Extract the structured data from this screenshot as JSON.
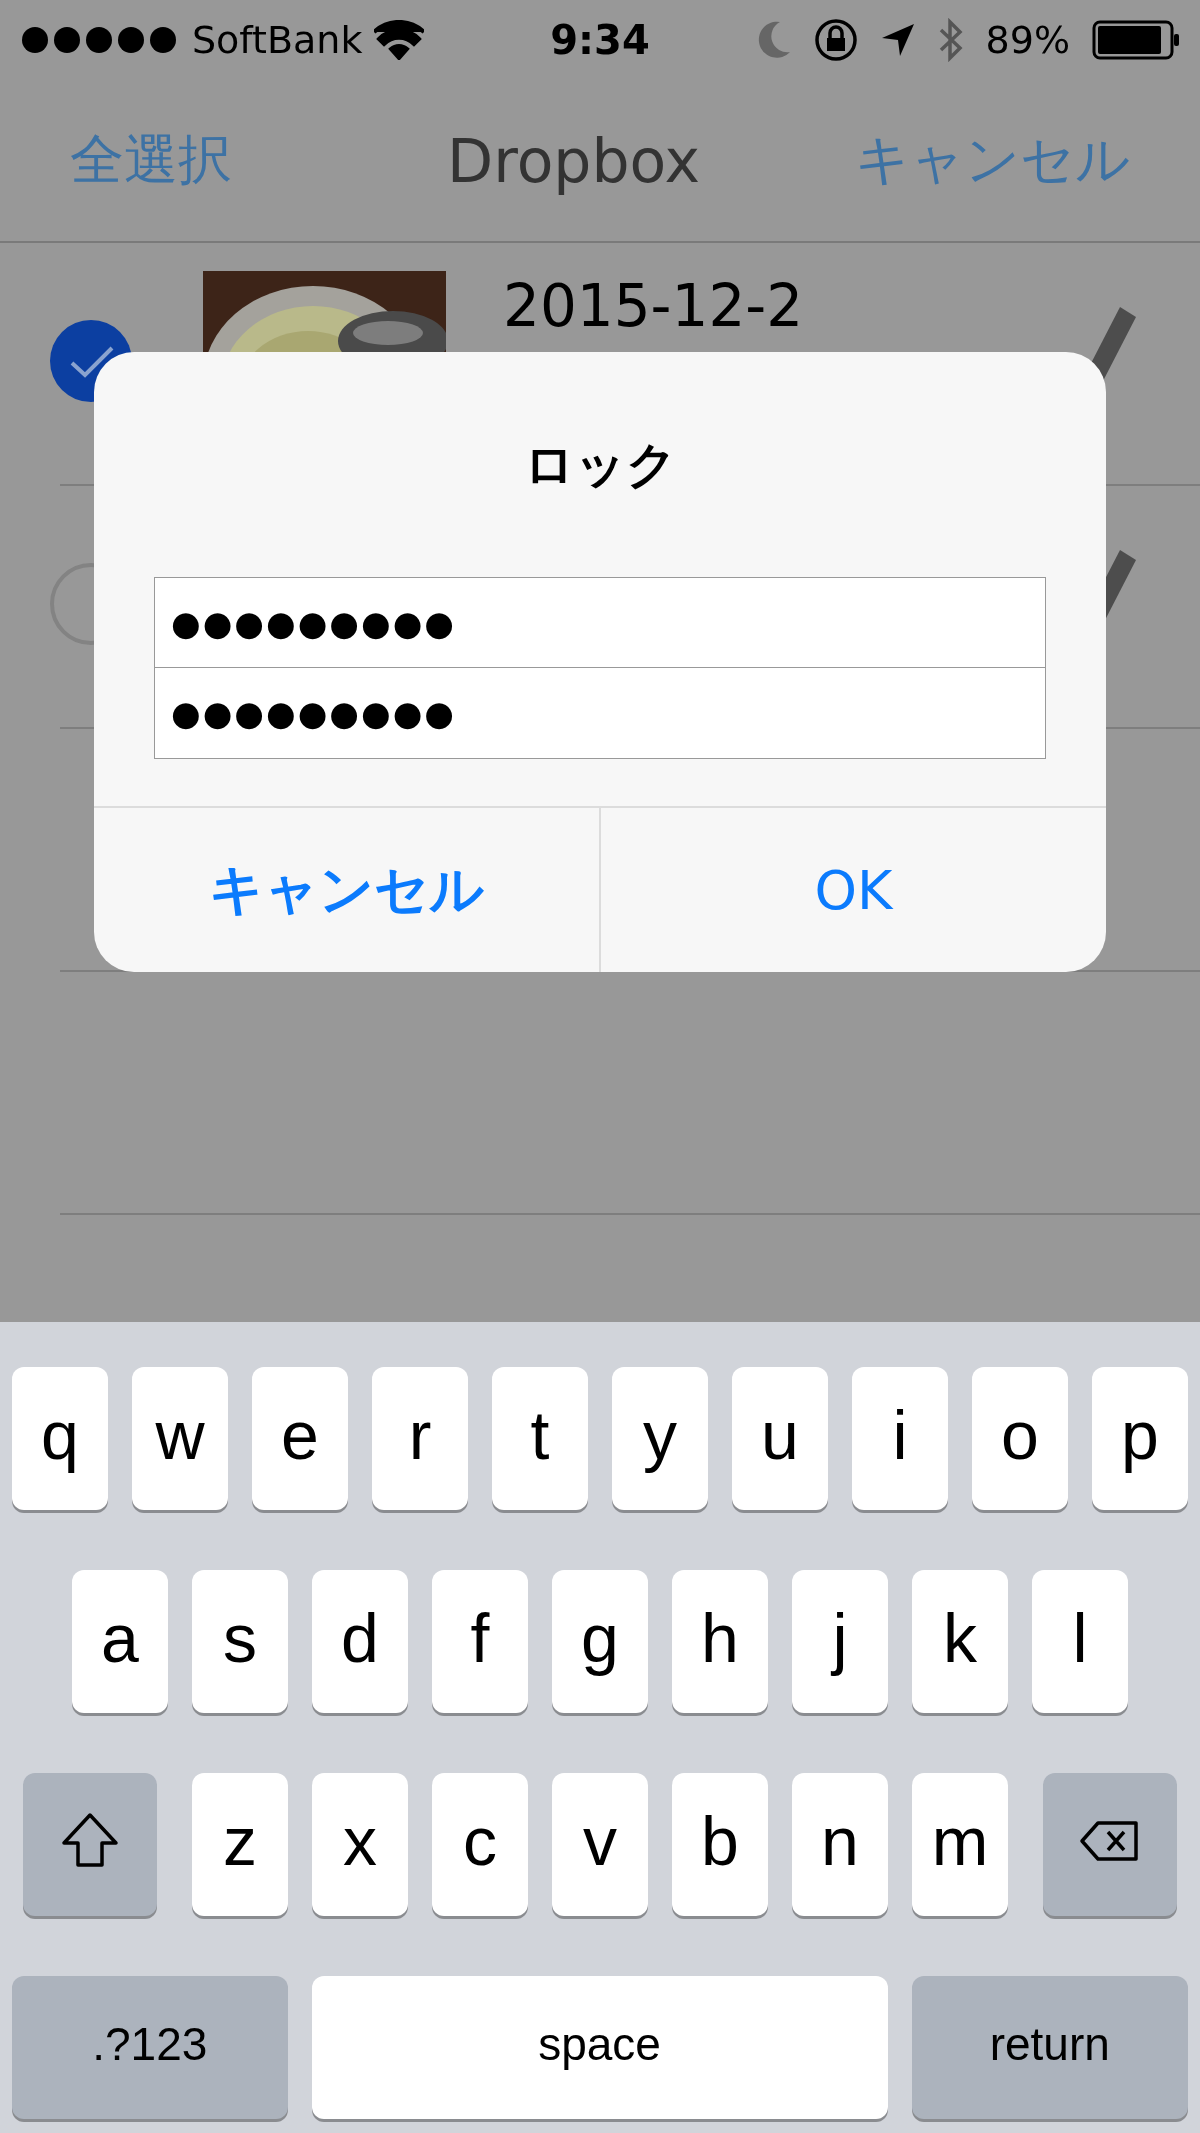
{
  "status_bar": {
    "carrier": "SoftBank",
    "time": "9:34",
    "battery": "89%"
  },
  "nav": {
    "left": "全選択",
    "title": "Dropbox",
    "right": "キャンセル"
  },
  "files": [
    {
      "name": "2015-12-2",
      "selected": true
    },
    {
      "selected": false
    }
  ],
  "dialog": {
    "title": "ロック",
    "fields": [
      {
        "value": "●●●●●●●●●"
      },
      {
        "value": "●●●●●●●●●"
      }
    ],
    "buttons": [
      {
        "label": "キャンセル",
        "kind": "cancel"
      },
      {
        "label": "OK",
        "kind": "default"
      }
    ]
  },
  "keyboard": {
    "rows": [
      {
        "keys": [
          {
            "kind": "letter",
            "label": "q"
          },
          {
            "kind": "letter",
            "label": "w"
          },
          {
            "kind": "letter",
            "label": "e"
          },
          {
            "kind": "letter",
            "label": "r"
          },
          {
            "kind": "letter",
            "label": "t"
          },
          {
            "kind": "letter",
            "label": "y"
          },
          {
            "kind": "letter",
            "label": "u"
          },
          {
            "kind": "letter",
            "label": "i"
          },
          {
            "kind": "letter",
            "label": "o"
          },
          {
            "kind": "letter",
            "label": "p"
          }
        ]
      },
      {
        "keys": [
          {
            "kind": "letter",
            "label": "a"
          },
          {
            "kind": "letter",
            "label": "s"
          },
          {
            "kind": "letter",
            "label": "d"
          },
          {
            "kind": "letter",
            "label": "f"
          },
          {
            "kind": "letter",
            "label": "g"
          },
          {
            "kind": "letter",
            "label": "h"
          },
          {
            "kind": "letter",
            "label": "j"
          },
          {
            "kind": "letter",
            "label": "k"
          },
          {
            "kind": "letter",
            "label": "l"
          }
        ]
      },
      {
        "keys": [
          {
            "kind": "shift"
          },
          {
            "kind": "letter",
            "label": "z"
          },
          {
            "kind": "letter",
            "label": "x"
          },
          {
            "kind": "letter",
            "label": "c"
          },
          {
            "kind": "letter",
            "label": "v"
          },
          {
            "kind": "letter",
            "label": "b"
          },
          {
            "kind": "letter",
            "label": "n"
          },
          {
            "kind": "letter",
            "label": "m"
          },
          {
            "kind": "delete"
          }
        ]
      },
      {
        "keys": [
          {
            "kind": "mode",
            "label": ".?123"
          },
          {
            "kind": "space",
            "label": "space"
          },
          {
            "kind": "return",
            "label": "return"
          }
        ]
      }
    ]
  }
}
